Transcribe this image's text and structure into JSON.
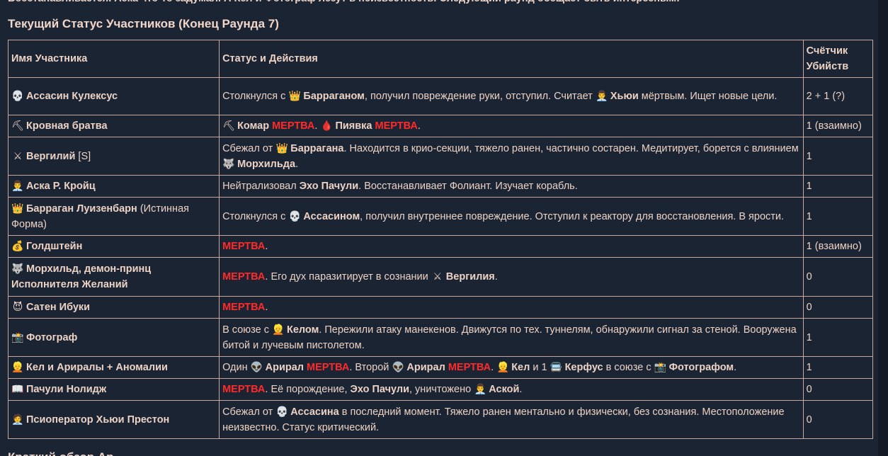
{
  "top_text": "Восстанавливается. Аска что-то задумал. А Кел и Фотограф лезут в неизвестность. Следующий раунд обещает быть интересным!",
  "section_title": "Текущий Статус Участников (Конец Раунда 7)",
  "bottom_text": "Краткий обзор Ар",
  "colors": {
    "background": "#1b2433",
    "text": "#ecd2c4",
    "dead": "#ff2a2a",
    "border": "#c9a79a"
  },
  "headers": {
    "name": "Имя Участника",
    "status": "Статус и Действия",
    "kills": "Счётчик Убийств"
  },
  "rows": [
    {
      "icon": "💀",
      "icon_name": "skull-icon",
      "name": "Ассасин Кулексус",
      "name_extra": "",
      "kills": "2 + 1 (?)"
    },
    {
      "icon": "⛏",
      "icon_name": "pick-icon",
      "name": "Кровная братва",
      "name_extra": "",
      "kills": "1 (взаимно)"
    },
    {
      "icon": "⚔",
      "icon_name": "swords-icon",
      "name": "Вергилий",
      "name_extra": "[S]",
      "kills": "1"
    },
    {
      "icon": "👨‍💼",
      "icon_name": "person-icon",
      "name": "Аска Р. Кройц",
      "name_extra": "",
      "kills": "1"
    },
    {
      "icon": "👑",
      "icon_name": "crown-icon",
      "name": "Барраган Луизенбарн",
      "name_extra": "(Истинная Форма)",
      "kills": "1"
    },
    {
      "icon": "💰",
      "icon_name": "money-bag-icon",
      "name": "Голдштейн",
      "name_extra": "",
      "kills": "1 (взаимно)"
    },
    {
      "icon": "🐺",
      "icon_name": "wolf-icon",
      "name": "Морхильд, демон-принц Исполнителя Желаний",
      "name_extra": "",
      "kills": "0"
    },
    {
      "icon": "😈",
      "icon_name": "devil-icon",
      "name": "Сатен Ибуки",
      "name_extra": "",
      "kills": "0"
    },
    {
      "icon": "📸",
      "icon_name": "camera-icon",
      "name": "Фотограф",
      "name_extra": "",
      "kills": "1"
    },
    {
      "icon": "👱",
      "icon_name": "blond-person-icon",
      "name": "Кел и Ариралы + Аномалии",
      "name_extra": "",
      "kills": "1"
    },
    {
      "icon": "📖",
      "icon_name": "book-icon",
      "name": "Пачули Нолидж",
      "name_extra": "",
      "kills": "0"
    },
    {
      "icon": "🧑‍💼",
      "icon_name": "operator-icon",
      "name": "Псиоператор Хьюи Престон",
      "name_extra": "",
      "kills": "0"
    }
  ],
  "status": {
    "r0": {
      "t1": "Столкнулся с ",
      "i1": "👑",
      "b1": "Барраганом",
      "t2": ", получил повреждение руки, отступил. Считает ",
      "i2": "👨‍💼",
      "b2": "Хьюи",
      "t3": " мёртвым. Ищет новые цели."
    },
    "r1": {
      "i1": "⛏",
      "b1": "Комар",
      "d1": "МЕРТВА",
      "t1": ". ",
      "i2": "🩸",
      "b2": "Пиявка",
      "d2": "МЕРТВА",
      "t2": "."
    },
    "r2": {
      "t1": "Сбежал от ",
      "i1": "👑",
      "b1": "Баррагана",
      "t2": ". Находится в крио-секции, тяжело ранен, частично состарен. Медитирует, борется с влиянием ",
      "i2": "🐺",
      "b2": "Морхильда",
      "t3": "."
    },
    "r3": {
      "t1": "Нейтрализовал ",
      "b1": "Эхо Пачули",
      "t2": ". Восстанавливает Фолиант. Изучает корабль."
    },
    "r4": {
      "t1": "Столкнулся с ",
      "i1": "💀",
      "b1": "Ассасином",
      "t2": ", получил внутреннее повреждение. Отступил к реактору для восстановления. В ярости."
    },
    "r5": {
      "d1": "МЕРТВА",
      "t1": "."
    },
    "r6": {
      "d1": "МЕРТВА",
      "t1": ". Его дух паразитирует в сознании ",
      "i1": "⚔",
      "b1": "Вергилия",
      "t2": "."
    },
    "r7": {
      "d1": "МЕРТВА",
      "t1": "."
    },
    "r8": {
      "t1": "В союзе с ",
      "i1": "👱",
      "b1": "Келом",
      "t2": ". Пережили атаку манекенов. Движутся по тех. туннелям, обнаружили сигнал за стеной. Вооружена битой и лучевым пистолетом."
    },
    "r9": {
      "t1": "Один ",
      "i1": "👽",
      "b1": "Арирал",
      "d1": "МЕРТВА",
      "t2": ". Второй ",
      "i2": "👽",
      "b2": "Арирал",
      "d2": "МЕРТВА",
      "t3": ". ",
      "i3": "👱",
      "b3": "Кел",
      "t4": " и 1 ",
      "i4": "🚍",
      "b4": "Керфус",
      "t5": " в союзе с ",
      "i5": "📸",
      "b5": "Фотографом",
      "t6": "."
    },
    "r10": {
      "d1": "МЕРТВА",
      "t1": ". Её порождение, ",
      "b1": "Эхо Пачули",
      "t2": ", уничтожено ",
      "i1": "👨‍💼",
      "b2": "Аской",
      "t3": "."
    },
    "r11": {
      "t1": "Сбежал от ",
      "i1": "💀",
      "b1": "Ассасина",
      "t2": " в последний момент. Тяжело ранен ментально и физически, без сознания. Местоположение неизвестно. Статус критический."
    }
  }
}
